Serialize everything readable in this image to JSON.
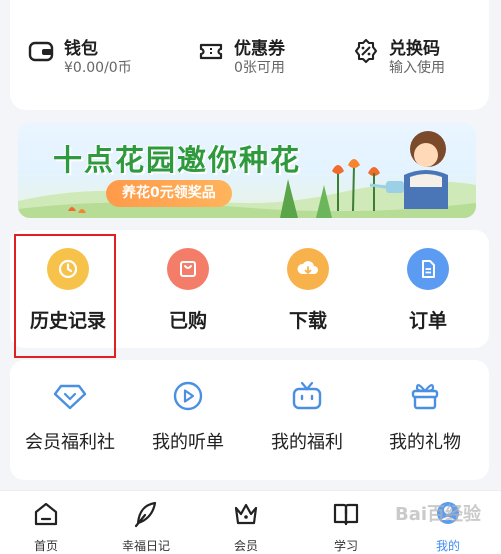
{
  "wallet": {
    "items": [
      {
        "title": "钱包",
        "subtitle": "¥0.00/0币",
        "icon": "wallet-icon"
      },
      {
        "title": "优惠券",
        "subtitle": "0张可用",
        "icon": "coupon-icon"
      },
      {
        "title": "兑换码",
        "subtitle": "输入使用",
        "icon": "redeem-code-icon"
      }
    ]
  },
  "banner": {
    "title": "十点花园邀你种花",
    "button_label": "养花0元领奖品"
  },
  "quick_actions": {
    "items": [
      {
        "label": "历史记录",
        "icon": "clock-icon",
        "color": "#f7c24a"
      },
      {
        "label": "已购",
        "icon": "bag-icon",
        "color": "#f47d6a"
      },
      {
        "label": "下载",
        "icon": "download-cloud-icon",
        "color": "#f8b24c"
      },
      {
        "label": "订单",
        "icon": "order-doc-icon",
        "color": "#5b9bf2"
      }
    ]
  },
  "services": {
    "items": [
      {
        "label": "会员福利社",
        "icon": "diamond-icon"
      },
      {
        "label": "我的听单",
        "icon": "play-circle-icon"
      },
      {
        "label": "我的福利",
        "icon": "tv-gift-icon"
      },
      {
        "label": "我的礼物",
        "icon": "gift-icon"
      }
    ]
  },
  "tabbar": {
    "items": [
      {
        "label": "首页",
        "icon": "home-icon"
      },
      {
        "label": "幸福日记",
        "icon": "quill-icon"
      },
      {
        "label": "会员",
        "icon": "crown-icon"
      },
      {
        "label": "学习",
        "icon": "book-icon"
      },
      {
        "label": "我的",
        "icon": "profile-icon",
        "active": true
      }
    ]
  },
  "watermark": "Bai百经验",
  "colors": {
    "accent": "#3f8cf3",
    "icon_stroke": "#4a90e2",
    "highlight": "#e02020"
  }
}
